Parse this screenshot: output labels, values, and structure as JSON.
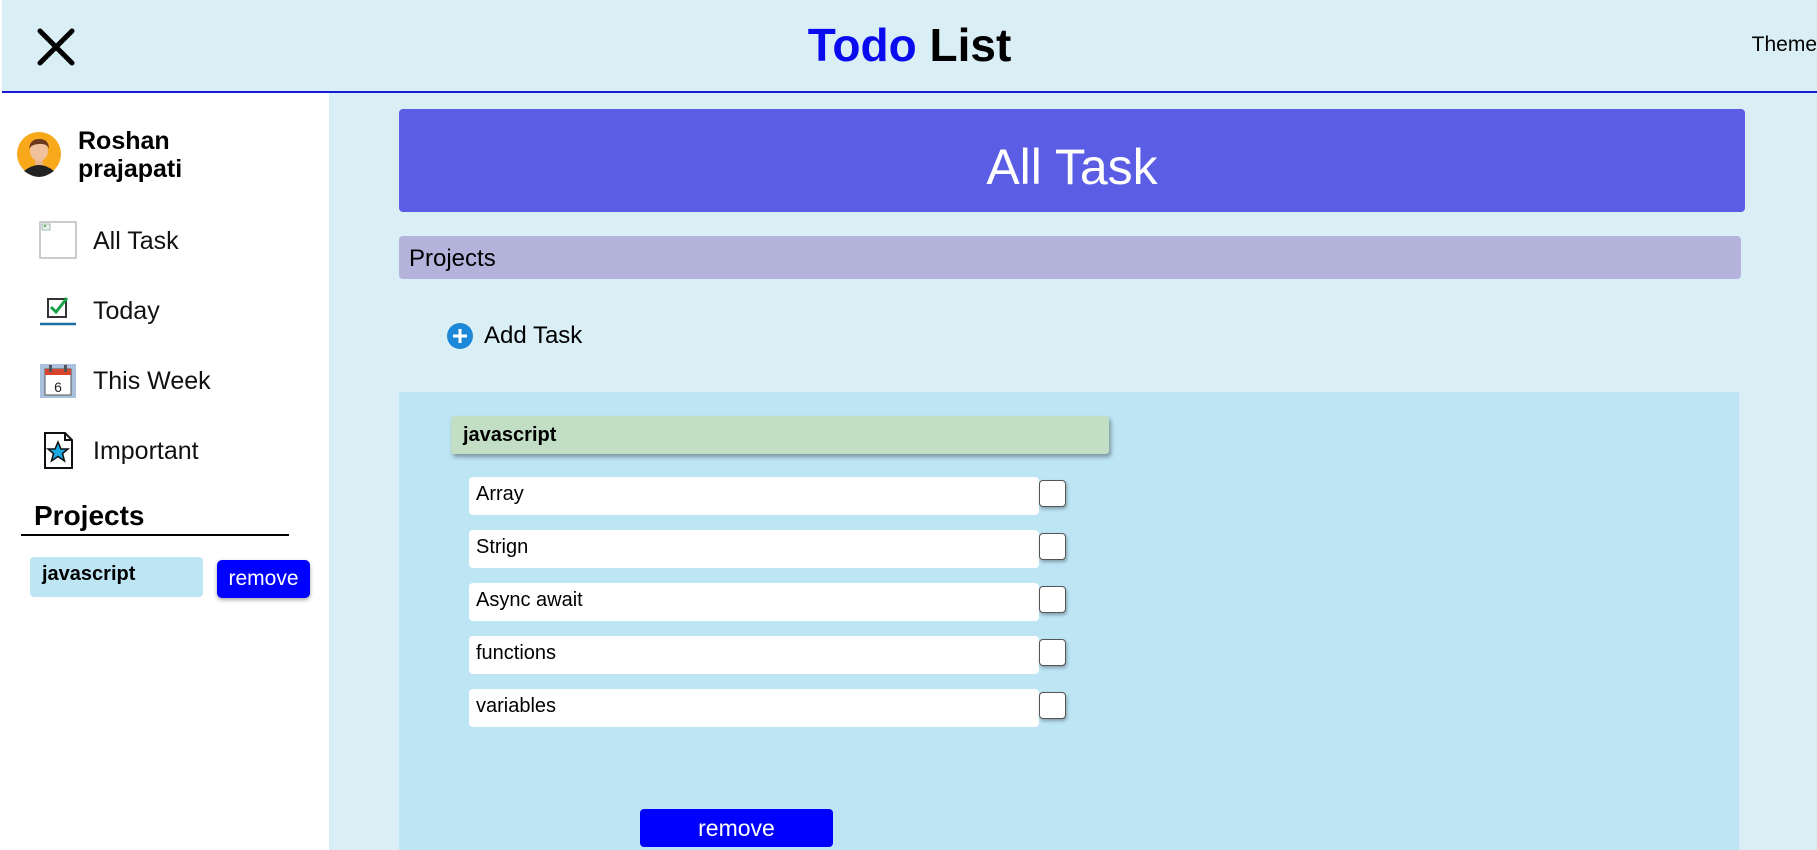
{
  "header": {
    "title_part1": "Todo",
    "title_part2": "List",
    "theme_label": "Theme"
  },
  "user": {
    "name": "Roshan prajapati"
  },
  "sidebar": {
    "items": [
      {
        "label": "All Task",
        "icon": "broken-image-icon"
      },
      {
        "label": "Today",
        "icon": "checkbox-icon"
      },
      {
        "label": "This Week",
        "icon": "calendar-icon"
      },
      {
        "label": "Important",
        "icon": "star-document-icon"
      }
    ],
    "projects_heading": "Projects",
    "projects": [
      {
        "name": "javascript",
        "remove_label": "remove"
      }
    ]
  },
  "main": {
    "banner": "All Task",
    "projects_bar": "Projects",
    "add_task_label": "Add Task",
    "project": {
      "title": "javascript",
      "tasks": [
        {
          "text": "Array",
          "done": false
        },
        {
          "text": "Strign",
          "done": false
        },
        {
          "text": "Async await",
          "done": false
        },
        {
          "text": "functions",
          "done": false
        },
        {
          "text": "variables",
          "done": false
        }
      ],
      "remove_label": "remove"
    }
  },
  "colors": {
    "accent_blue": "#0000ff",
    "banner": "#5b5ee5",
    "header_bg": "#daeef6",
    "panel_bg": "#bde5f4",
    "project_title_bg": "#c2dfc6",
    "projects_bar_bg": "#b3b3dc"
  }
}
